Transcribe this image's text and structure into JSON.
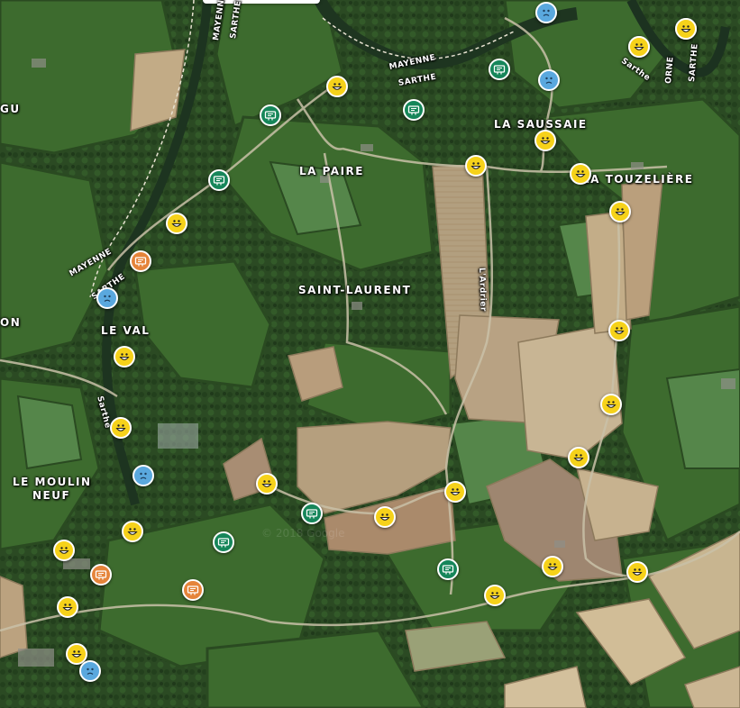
{
  "map": {
    "places": {
      "la_saussaie": "LA SAUSSAIE",
      "la_paire": "LA PAIRE",
      "la_touzeliere": "LA TOUZELIÈRE",
      "saint_laurent": "SAINT-LAURENT",
      "le_val": "LE VAL",
      "le_moulin_neuf_1": "LE MOULIN",
      "le_moulin_neuf_2": "NEUF",
      "gu": "GU",
      "on": "ON"
    },
    "rivers_roads": {
      "mayenne_top": "MAYENNE",
      "sarthe_top": "SARTHE",
      "mayenne_river": "MAYENNE",
      "sarthe_river": "SARTHE",
      "sarthe_right": "Sarthe",
      "orne": "ORNE",
      "sarthe_far_right": "SARTHE",
      "mayenne_left": "MAYENNE",
      "sarthe_left": "SARTHE",
      "sarthe_stream": "Sarthe",
      "l_ardrier": "L'Ardrier"
    },
    "watermark": "© 2018 Google",
    "marker_colors": {
      "yellow": "#f6d21a",
      "green": "#16865a",
      "blue": "#5aa8de",
      "orange": "#e5843a"
    },
    "markers": [
      {
        "type": "yellow",
        "icon": "smiley-happy-icon"
      },
      {
        "type": "yellow",
        "icon": "smiley-happy-icon"
      },
      {
        "type": "yellow",
        "icon": "smiley-happy-icon"
      },
      {
        "type": "yellow",
        "icon": "smiley-happy-icon"
      },
      {
        "type": "yellow",
        "icon": "smiley-happy-icon"
      },
      {
        "type": "yellow",
        "icon": "smiley-happy-icon"
      },
      {
        "type": "yellow",
        "icon": "smiley-happy-icon"
      },
      {
        "type": "yellow",
        "icon": "smiley-happy-icon"
      },
      {
        "type": "yellow",
        "icon": "smiley-happy-icon"
      },
      {
        "type": "yellow",
        "icon": "smiley-happy-icon"
      },
      {
        "type": "yellow",
        "icon": "smiley-happy-icon"
      },
      {
        "type": "yellow",
        "icon": "smiley-happy-icon"
      },
      {
        "type": "yellow",
        "icon": "smiley-happy-icon"
      },
      {
        "type": "yellow",
        "icon": "smiley-happy-icon"
      },
      {
        "type": "yellow",
        "icon": "smiley-happy-icon"
      },
      {
        "type": "yellow",
        "icon": "smiley-happy-icon"
      },
      {
        "type": "yellow",
        "icon": "smiley-happy-icon"
      },
      {
        "type": "yellow",
        "icon": "smiley-happy-icon"
      },
      {
        "type": "yellow",
        "icon": "smiley-happy-icon"
      },
      {
        "type": "yellow",
        "icon": "smiley-happy-icon"
      },
      {
        "type": "yellow",
        "icon": "smiley-happy-icon"
      },
      {
        "type": "yellow",
        "icon": "smiley-happy-icon"
      },
      {
        "type": "yellow",
        "icon": "smiley-happy-icon"
      },
      {
        "type": "yellow",
        "icon": "smiley-happy-icon"
      },
      {
        "type": "yellow",
        "icon": "smiley-happy-icon"
      },
      {
        "type": "blue",
        "icon": "smiley-sad-icon"
      },
      {
        "type": "blue",
        "icon": "smiley-sad-icon"
      },
      {
        "type": "blue",
        "icon": "smiley-sad-icon"
      },
      {
        "type": "blue",
        "icon": "smiley-sad-icon"
      },
      {
        "type": "blue",
        "icon": "smiley-sad-icon"
      },
      {
        "type": "green",
        "icon": "sign-board-icon"
      },
      {
        "type": "green",
        "icon": "sign-board-icon"
      },
      {
        "type": "green",
        "icon": "sign-board-icon"
      },
      {
        "type": "green",
        "icon": "sign-board-icon"
      },
      {
        "type": "green",
        "icon": "sign-board-icon"
      },
      {
        "type": "green",
        "icon": "sign-board-icon"
      },
      {
        "type": "green",
        "icon": "sign-board-icon"
      },
      {
        "type": "orange",
        "icon": "sign-board-icon"
      },
      {
        "type": "orange",
        "icon": "sign-board-icon"
      },
      {
        "type": "orange",
        "icon": "sign-board-icon"
      }
    ]
  }
}
